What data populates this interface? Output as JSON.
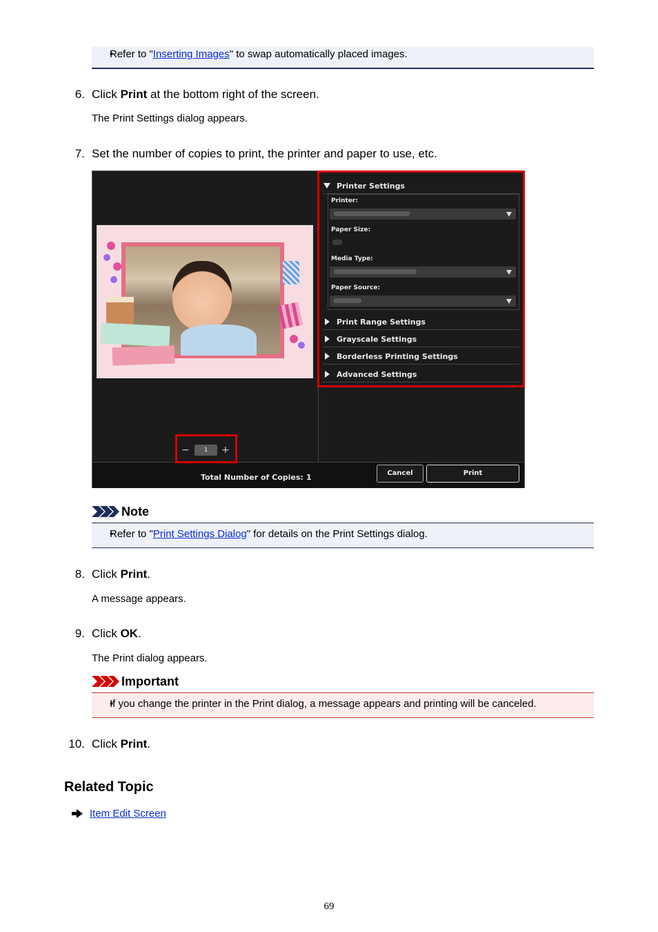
{
  "top_note": {
    "bullet": "•",
    "pre": "Refer to \"",
    "link": "Inserting Images",
    "post": "\" to swap automatically placed images."
  },
  "steps": [
    {
      "num": "6.",
      "pre": "Click ",
      "bold": "Print",
      "post": " at the bottom right of the screen.",
      "sub": "The Print Settings dialog appears."
    },
    {
      "num": "7.",
      "pre": "Set the number of copies to print, the printer and paper to use, etc.",
      "bold": "",
      "post": "",
      "sub": ""
    },
    {
      "num": "8.",
      "pre": "Click ",
      "bold": "Print",
      "post": ".",
      "sub": "A message appears."
    },
    {
      "num": "9.",
      "pre": "Click ",
      "bold": "OK",
      "post": ".",
      "sub": "The Print dialog appears."
    },
    {
      "num": "10.",
      "pre": "Click ",
      "bold": "Print",
      "post": ".",
      "sub": ""
    }
  ],
  "screenshot": {
    "printer_settings": "Printer Settings",
    "printer_label": "Printer:",
    "paper_size_label": "Paper Size:",
    "media_type_label": "Media Type:",
    "paper_source_label": "Paper Source:",
    "sections": [
      "Print Range Settings",
      "Grayscale Settings",
      "Borderless Printing Settings",
      "Advanced Settings"
    ],
    "copies_value": "1",
    "minus": "−",
    "plus": "+",
    "total_label": "Total Number of Copies:",
    "total_value": "1",
    "cancel": "Cancel",
    "print": "Print"
  },
  "note": {
    "title": "Note",
    "bullet": "•",
    "pre": "Refer to \"",
    "link": "Print Settings Dialog",
    "post": "\" for details on the Print Settings dialog."
  },
  "important": {
    "title": "Important",
    "bullet": "•",
    "text": "If you change the printer in the Print dialog, a message appears and printing will be canceled."
  },
  "related": {
    "heading": "Related Topic",
    "link": "Item Edit Screen"
  },
  "page_number": "69",
  "colors": {
    "link": "#0b2bd8",
    "note_border": "#1f2d5a",
    "important_border": "#c0392b",
    "highlight_red": "#d40000"
  }
}
